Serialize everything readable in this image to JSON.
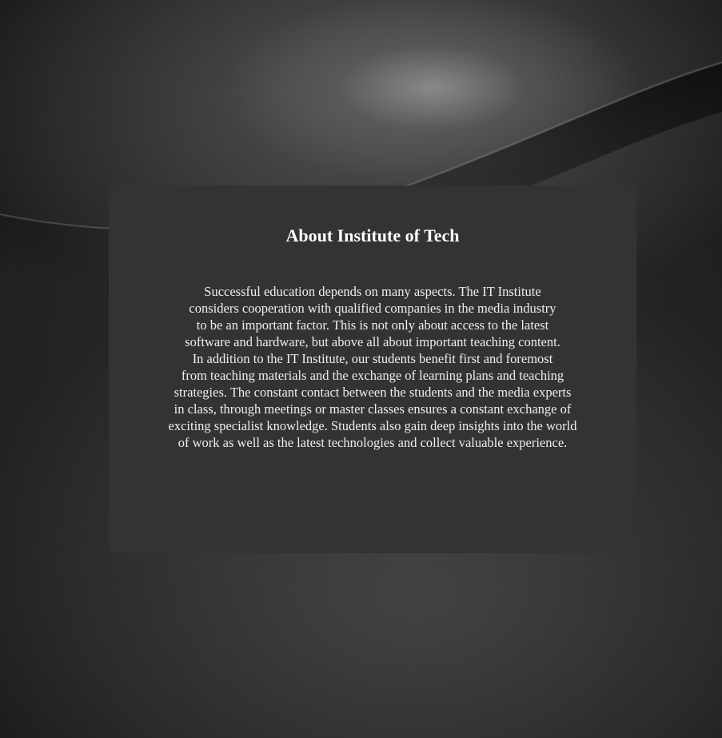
{
  "about": {
    "title": "About Institute of Tech",
    "lines": [
      "Successful education depends on many aspects. The IT Institute",
      "considers cooperation with qualified companies in the media industry",
      "to be an important factor. This is not only about access to the latest",
      "software and hardware, but above all about important teaching content.",
      "In addition to the IT Institute, our students benefit first and foremost",
      "from teaching materials and the exchange of learning plans and teaching",
      "strategies. The constant contact between the students and the media experts",
      "in class, through meetings or master classes ensures a constant exchange of",
      "exciting specialist knowledge. Students also gain deep insights into the world",
      "of work as well as the latest technologies and collect valuable experience."
    ]
  },
  "colors": {
    "card_background": "#333333",
    "page_background": "#1a1a1a",
    "text": "#eeeeee"
  }
}
